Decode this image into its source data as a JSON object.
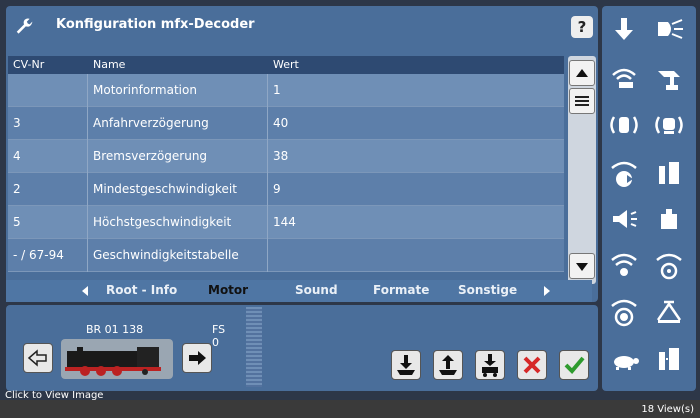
{
  "title": "Konfiguration mfx-Decoder",
  "help_label": "?",
  "columns": [
    "CV-Nr",
    "Name",
    "Wert"
  ],
  "rows": [
    {
      "cv": "",
      "name": "Motorinformation",
      "value": "1"
    },
    {
      "cv": "3",
      "name": "Anfahrverzögerung",
      "value": "40"
    },
    {
      "cv": "4",
      "name": "Bremsverzögerung",
      "value": "38"
    },
    {
      "cv": "2",
      "name": "Mindestgeschwindigkeit",
      "value": "9"
    },
    {
      "cv": "5",
      "name": "Höchstgeschwindigkeit",
      "value": "144"
    },
    {
      "cv": "- / 67-94",
      "name": "Geschwindigkeitstabelle",
      "value": ""
    }
  ],
  "tabs": [
    "Root - Info",
    "Motor",
    "Sound",
    "Formate",
    "Sonstige"
  ],
  "active_tab": "Motor",
  "loco": {
    "name": "BR 01 138",
    "fs_label": "FS",
    "fs_value": "0"
  },
  "footer": {
    "left": "Click to View Image",
    "right": "18 View(s)"
  },
  "colors": {
    "panel": "#4a6e9a",
    "header": "#2e4a72",
    "row_even": "#6f8fb6",
    "row_odd": "#5d7faa",
    "cancel": "#d62828",
    "confirm": "#2e9b2e"
  }
}
